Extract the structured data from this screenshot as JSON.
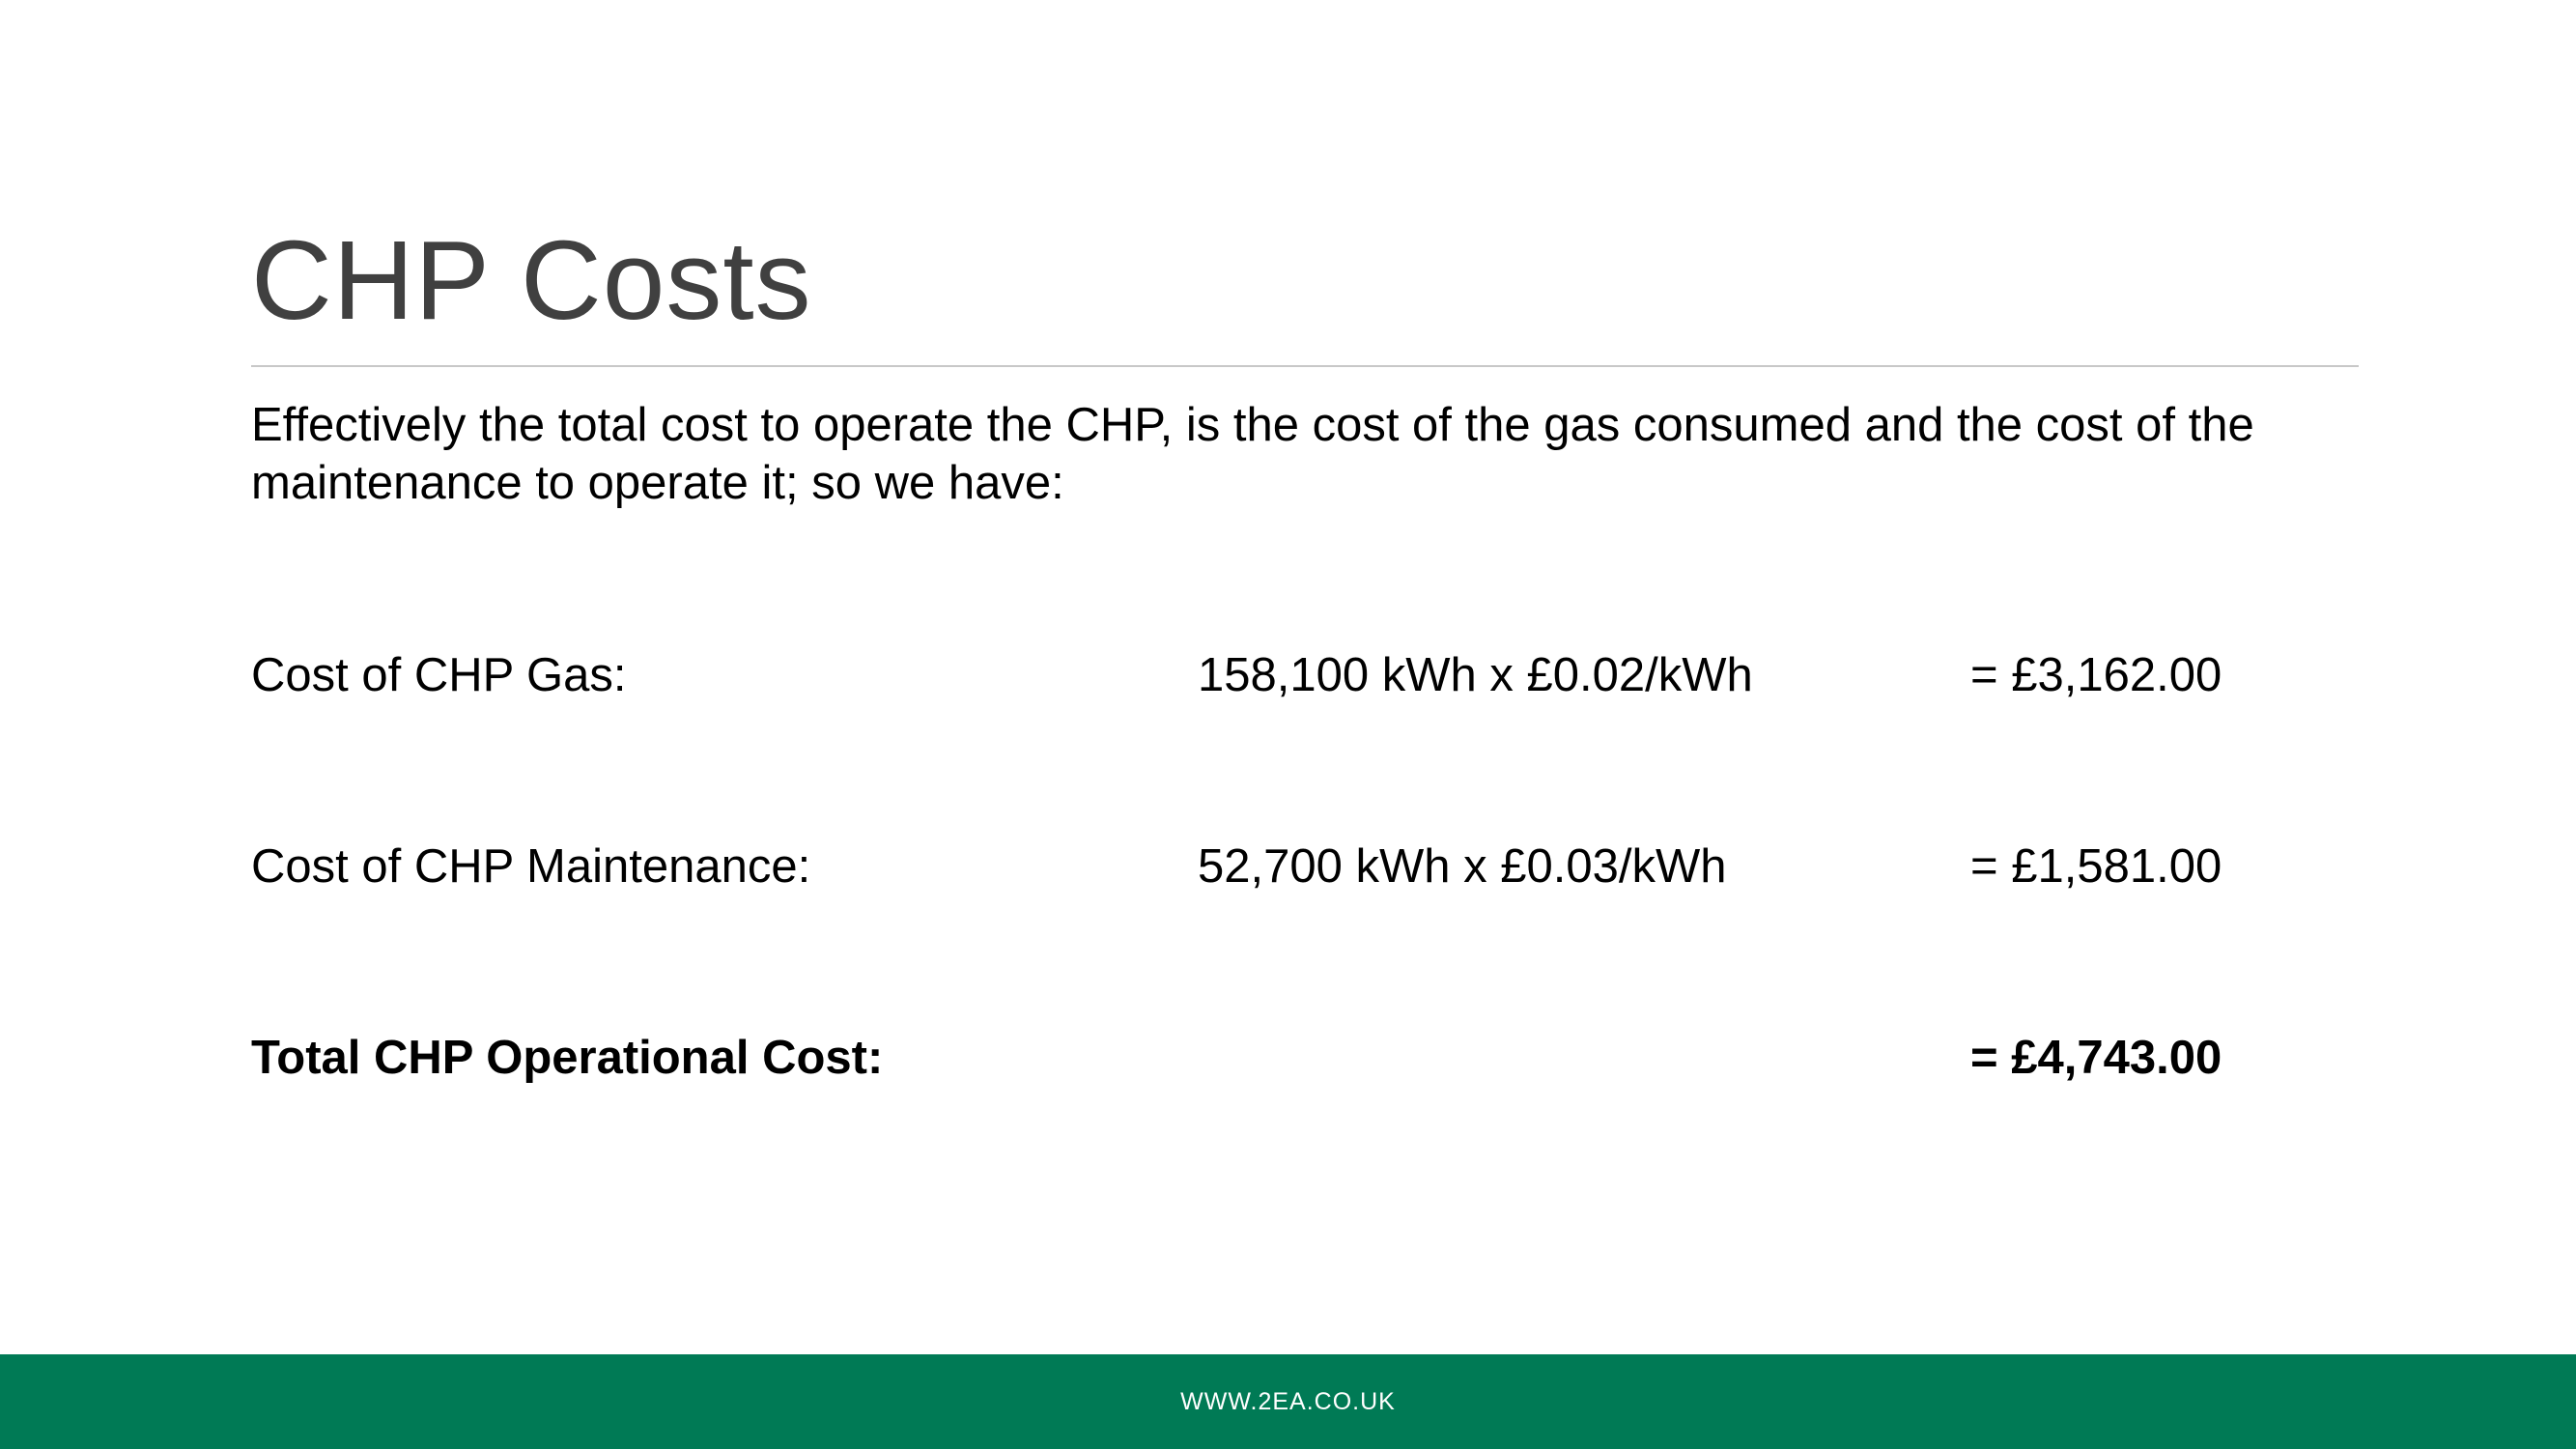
{
  "slide": {
    "title": "CHP Costs",
    "intro": "Effectively the total cost to operate the CHP, is the cost of the gas consumed and the cost of the maintenance to operate it; so we have:"
  },
  "costs": {
    "gas": {
      "label": "Cost of CHP Gas:",
      "calculation": "158,100 kWh x £0.02/kWh",
      "result": "= £3,162.00"
    },
    "maintenance": {
      "label": "Cost of CHP Maintenance:",
      "calculation": "52,700 kWh x £0.03/kWh",
      "result": "= £1,581.00"
    },
    "total": {
      "label": "Total CHP Operational Cost:",
      "result": "= £4,743.00"
    }
  },
  "footer": {
    "url": "WWW.2EA.CO.UK",
    "color": "#007a55"
  }
}
